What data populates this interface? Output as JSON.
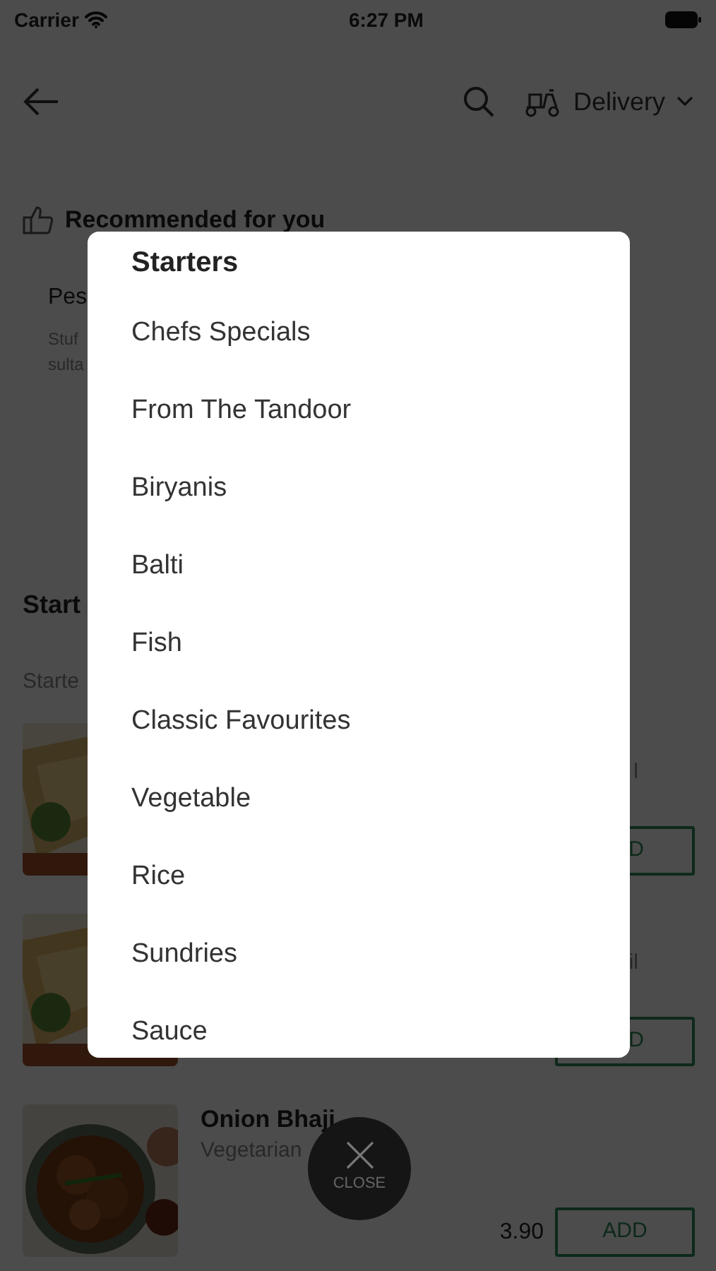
{
  "status_bar": {
    "carrier": "Carrier",
    "time": "6:27 PM"
  },
  "header": {
    "delivery_mode": "Delivery"
  },
  "recommended": {
    "heading": "Recommended for you",
    "card": {
      "title": "Pes",
      "description_lines": [
        "Stuf",
        "sulta"
      ]
    }
  },
  "section": {
    "title": "Start",
    "subtitle": "Starte"
  },
  "menu_items": [
    {
      "kind": "partial",
      "description": "l",
      "button": "D"
    },
    {
      "kind": "partial",
      "description": "il",
      "button": "D"
    },
    {
      "kind": "full",
      "name": "Onion Bhaji",
      "description": "Vegetarian",
      "price": "3.90",
      "button": "ADD"
    }
  ],
  "category_sheet": {
    "title": "Starters",
    "categories": [
      "Chefs Specials",
      "From The Tandoor",
      "Biryanis",
      "Balti",
      "Fish",
      "Classic Favourites",
      "Vegetable",
      "Rice",
      "Sundries",
      "Sauce"
    ]
  },
  "close_button": {
    "label": "CLOSE"
  }
}
